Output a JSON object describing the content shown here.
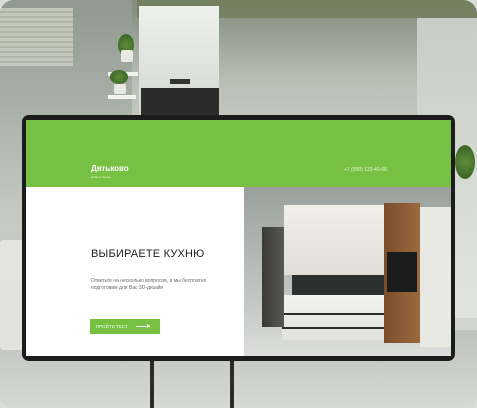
{
  "site": {
    "brand": "Дятьково",
    "tagline": "мебель бренд",
    "phone": "+7 (000) 123-45-66"
  },
  "hero": {
    "title": "ВЫБИРАЕТЕ КУХНЮ",
    "description": "Ответьте на несколько вопросов, а мы бесплатно подготовим для Вас 3D-дизайн",
    "cta_label": "ПРОЙТИ ТЕСТ"
  },
  "icons": {
    "cta_arrow": "arrow-right-icon"
  },
  "colors": {
    "accent": "#76c142",
    "monitor_frame": "#1c1c1c",
    "title_text": "#1d1d1d"
  }
}
